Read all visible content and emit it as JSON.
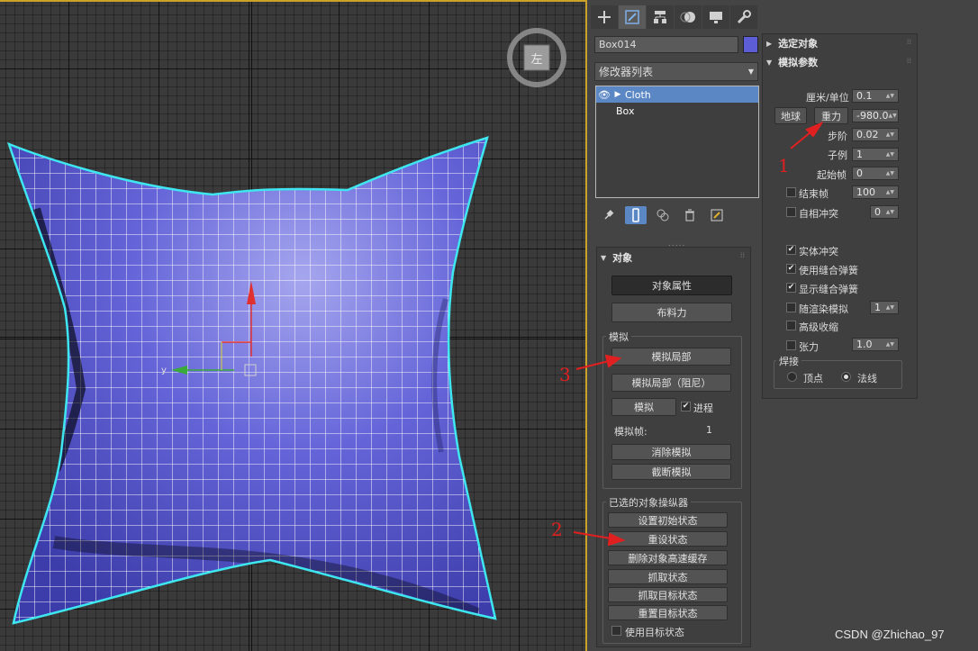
{
  "viewport": {
    "axis_label": "y",
    "cube_face": "左",
    "colors": {
      "cloth": "#5c5cd6",
      "selection": "#3ee6f0",
      "wire": "#ffffff",
      "frame": "#c9a227"
    }
  },
  "toolbar": {
    "tabs": [
      "create-icon",
      "modify-icon",
      "hierarchy-icon",
      "motion-icon",
      "display-icon",
      "utilities-icon"
    ]
  },
  "modifier": {
    "object_name": "Box014",
    "object_color": "#5d5dd6",
    "list_label": "修改器列表",
    "stack": [
      {
        "name": "Cloth",
        "selected": true
      },
      {
        "name": "Box",
        "selected": false
      }
    ]
  },
  "object_rollout": {
    "title": "对象",
    "object_props_btn": "对象属性",
    "cloth_forces_btn": "布料力",
    "sim_group": {
      "title": "模拟",
      "local_btn": "模拟局部",
      "local_damped_btn": "模拟局部（阻尼）",
      "simulate_btn": "模拟",
      "progress_label": "进程",
      "frames_label": "模拟帧:",
      "frames_value": "1",
      "erase_btn": "消除模拟",
      "truncate_btn": "截断模拟"
    },
    "selected_group": {
      "title": "已选的对象操纵器",
      "set_initial_btn": "设置初始状态",
      "reset_btn": "重设状态",
      "delete_cache_btn": "删除对象高速缓存",
      "grab_btn": "抓取状态",
      "grab_target_btn": "抓取目标状态",
      "reset_target_btn": "重置目标状态",
      "use_target_label": "使用目标状态"
    }
  },
  "right_column": {
    "selected_objects_title": "选定对象",
    "sim_params_title": "模拟参数",
    "cm_unit_label": "厘米/单位",
    "cm_unit_value": "0.1",
    "earth_btn": "地球",
    "gravity_btn": "重力",
    "gravity_value": "-980.0",
    "step_label": "步阶",
    "step_value": "0.02",
    "subsample_label": "子例",
    "subsample_value": "1",
    "start_frame_label": "起始帧",
    "start_frame_value": "0",
    "end_frame_label": "结束帧",
    "end_frame_value": "100",
    "self_collision_label": "自相冲突",
    "self_collision_value": "0",
    "solid_collision_label": "实体冲突",
    "use_sewing_label": "使用缝合弹簧",
    "show_sewing_label": "显示缝合弹簧",
    "render_sim_label": "随渲染模拟",
    "render_sim_value": "1",
    "adv_pinch_label": "高级收缩",
    "tension_label": "张力",
    "tension_value": "1.0",
    "weld_title": "焊接",
    "vertex_label": "顶点",
    "normal_label": "法线"
  },
  "annotations": {
    "a1": "1",
    "a2": "2",
    "a3": "3",
    "color": "#e02020"
  },
  "watermark": "CSDN @Zhichao_97"
}
